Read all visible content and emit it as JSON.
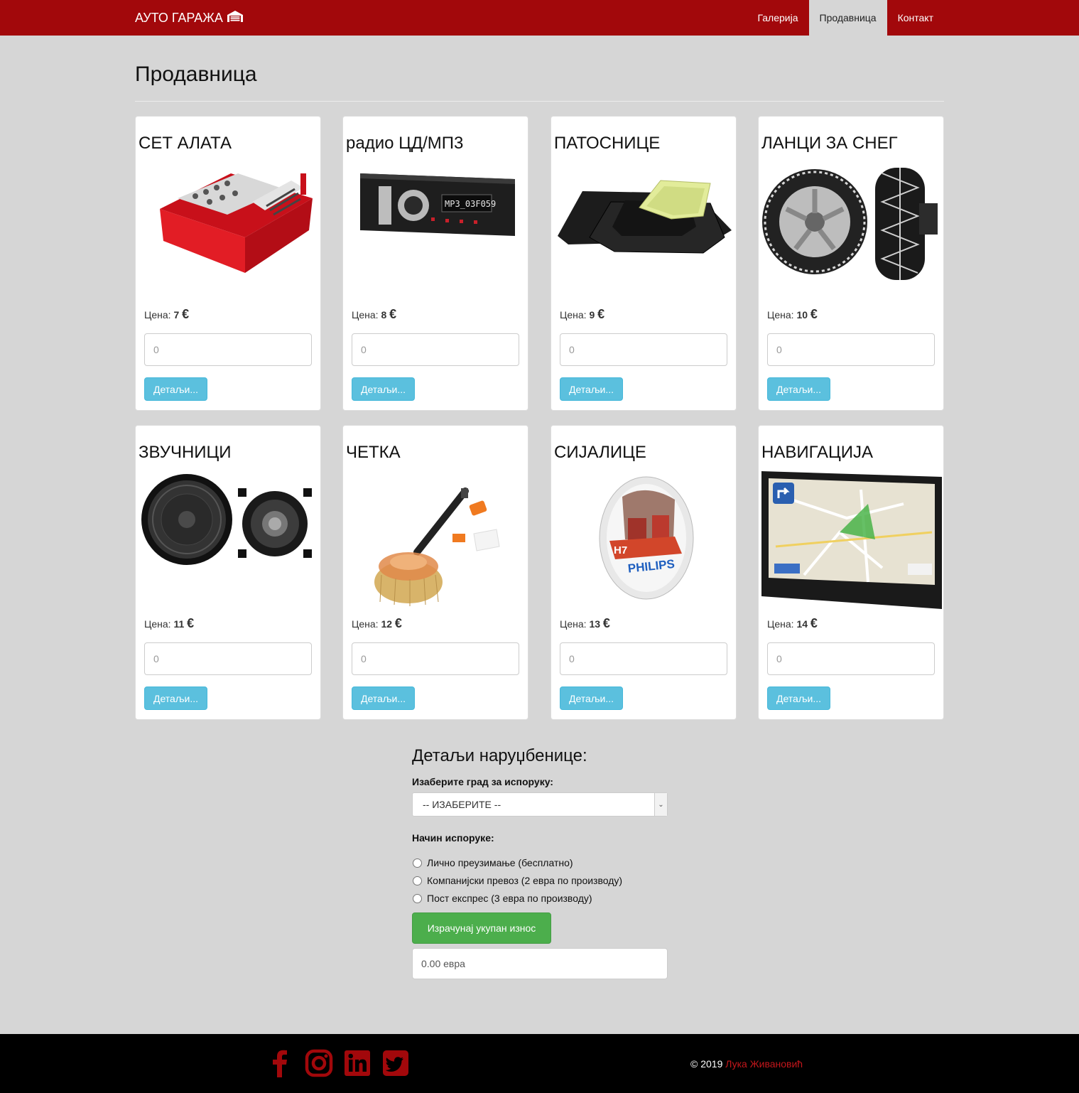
{
  "navbar": {
    "brand": "АУТО ГАРАЖА",
    "brand_icon": "garage-icon",
    "links": [
      {
        "label": "Галерија",
        "active": false
      },
      {
        "label": "Продавница",
        "active": true
      },
      {
        "label": "Контакт",
        "active": false
      }
    ],
    "color": "#a2080b"
  },
  "page": {
    "title": "Продавница"
  },
  "products": [
    {
      "name": "СЕТ АЛАТА",
      "image": "toolbox-image",
      "price_label": "Цена:",
      "price": "7",
      "currency": "€",
      "qty_placeholder": "0",
      "details": "Детаљи..."
    },
    {
      "name": "радио ЦД/МП3",
      "image": "car-radio-image",
      "price_label": "Цена:",
      "price": "8",
      "currency": "€",
      "qty_placeholder": "0",
      "details": "Детаљи..."
    },
    {
      "name": "ПАТОСНИЦЕ",
      "image": "floor-mats-image",
      "price_label": "Цена:",
      "price": "9",
      "currency": "€",
      "qty_placeholder": "0",
      "details": "Детаљи..."
    },
    {
      "name": "ЛАНЦИ ЗА СНЕГ",
      "image": "snow-chains-image",
      "price_label": "Цена:",
      "price": "10",
      "currency": "€",
      "qty_placeholder": "0",
      "details": "Детаљи..."
    },
    {
      "name": "ЗВУЧНИЦИ",
      "image": "speakers-image",
      "price_label": "Цена:",
      "price": "11",
      "currency": "€",
      "qty_placeholder": "0",
      "details": "Детаљи..."
    },
    {
      "name": "ЧЕТКА",
      "image": "brush-image",
      "price_label": "Цена:",
      "price": "12",
      "currency": "€",
      "qty_placeholder": "0",
      "details": "Детаљи..."
    },
    {
      "name": "СИЈАЛИЦЕ",
      "image": "bulbs-image",
      "price_label": "Цена:",
      "price": "13",
      "currency": "€",
      "qty_placeholder": "0",
      "details": "Детаљи..."
    },
    {
      "name": "НАВИГАЦИЈА",
      "image": "gps-navigation-image",
      "price_label": "Цена:",
      "price": "14",
      "currency": "€",
      "qty_placeholder": "0",
      "details": "Детаљи..."
    }
  ],
  "product_images_text": {
    "radio_display": "MP3_03F059",
    "bulb_model": "H7",
    "bulb_brand": "PHILIPS"
  },
  "order": {
    "heading": "Детаљи наруџбенице:",
    "city_label": "Изаберите град за испоруку:",
    "city_selected": "-- ИЗАБЕРИТЕ --",
    "delivery_label": "Начин испоруке:",
    "delivery_options": [
      "Лично преузимање (бесплатно)",
      "Компанијски превоз (2 евра по производу)",
      "Пост експрес (3 евра по производу)"
    ],
    "calculate_button": "Израчунај укупан износ",
    "total_placeholder": "0.00 евра"
  },
  "footer": {
    "social_icons": [
      "facebook-icon",
      "instagram-icon",
      "linkedin-icon",
      "twitter-icon"
    ],
    "copyright": "© 2019",
    "author": "Лука Живановић",
    "accent_color": "#c4161b"
  }
}
